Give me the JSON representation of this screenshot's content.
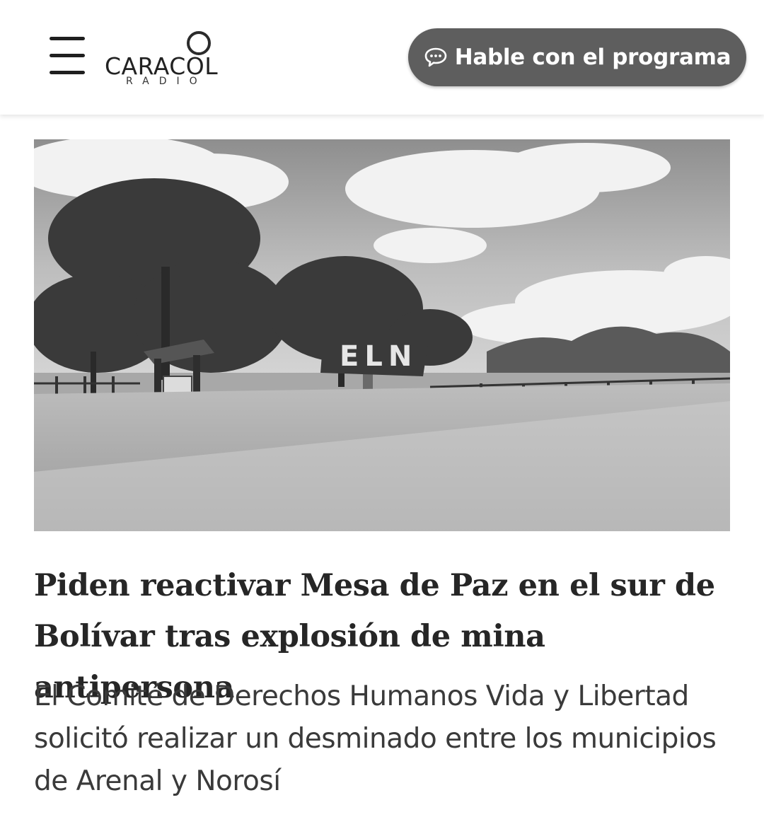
{
  "header": {
    "menu_icon": "hamburger-menu-icon",
    "logo": {
      "wordmark": "CARACOL",
      "sub": "RADIO"
    },
    "cta": {
      "label": "Hable con el programa",
      "icon": "chat-bubble-icon"
    }
  },
  "article": {
    "image": {
      "banner_text": "ELN"
    },
    "headline": "Piden reactivar Mesa de Paz en el sur de Bolívar tras explosión de mina antipersona",
    "summary": "El Comité de Derechos Humanos Vida y Libertad solicitó realizar un desminado entre los municipios de Arenal y Norosí"
  },
  "colors": {
    "cta_background": "#5e5e5e",
    "cta_text": "#ffffff",
    "headline": "#262626",
    "summary": "#3a3a3a"
  }
}
